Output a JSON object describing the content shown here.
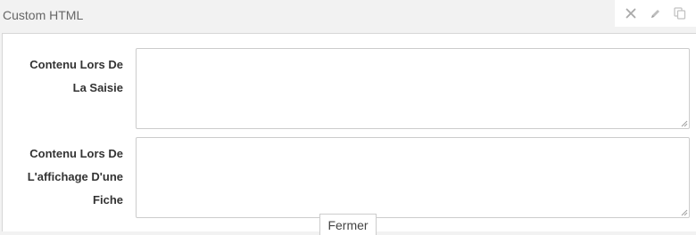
{
  "header": {
    "title": "Custom HTML"
  },
  "toolbar": {
    "icons": [
      "close-icon",
      "pencil-icon",
      "copy-icon"
    ]
  },
  "form": {
    "fields": [
      {
        "label_lines": [
          "Contenu Lors De",
          "La Saisie"
        ],
        "value": ""
      },
      {
        "label_lines": [
          "Contenu Lors De",
          "L'affichage D'une",
          "Fiche"
        ],
        "value": ""
      }
    ],
    "close_button_label": "Fermer"
  },
  "colors": {
    "background": "#f2f2f2",
    "panel": "#ffffff",
    "border": "#cccccc",
    "label_text": "#333333",
    "header_text": "#666666",
    "icon": "#b0b0b0"
  }
}
